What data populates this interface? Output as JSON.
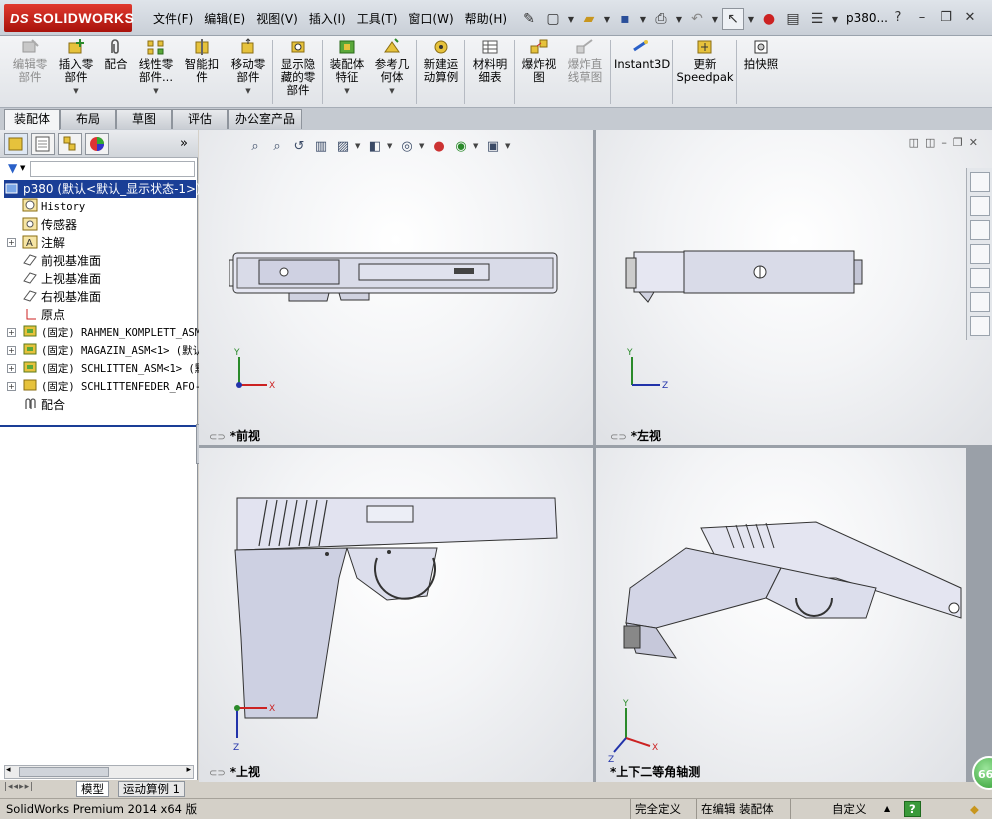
{
  "app": {
    "brand": "SOLIDWORKS",
    "brand_prefix": "DS",
    "doc_title": "p380..."
  },
  "menu": [
    "文件(F)",
    "编辑(E)",
    "视图(V)",
    "插入(I)",
    "工具(T)",
    "窗口(W)",
    "帮助(H)"
  ],
  "commands": [
    {
      "label": "编辑零\n部件",
      "disabled": true
    },
    {
      "label": "插入零\n部件",
      "disabled": false
    },
    {
      "label": "配合",
      "disabled": false
    },
    {
      "label": "线性零\n部件...",
      "disabled": false
    },
    {
      "label": "智能扣\n件",
      "disabled": false
    },
    {
      "label": "移动零\n部件",
      "disabled": false
    },
    {
      "label": "显示隐\n藏的零\n部件",
      "disabled": false
    },
    {
      "label": "装配体\n特征",
      "disabled": false
    },
    {
      "label": "参考几\n何体",
      "disabled": false
    },
    {
      "label": "新建运\n动算例",
      "disabled": false
    },
    {
      "label": "材料明\n细表",
      "disabled": false
    },
    {
      "label": "爆炸视\n图",
      "disabled": false
    },
    {
      "label": "爆炸直\n线草图",
      "disabled": true
    },
    {
      "label": "Instant3D",
      "disabled": false
    },
    {
      "label": "更新\nSpeedpak",
      "disabled": false
    },
    {
      "label": "拍快照",
      "disabled": false
    }
  ],
  "tabs": [
    "装配体",
    "布局",
    "草图",
    "评估",
    "办公室产品"
  ],
  "tree": {
    "root": "p380  (默认<默认_显示状态-1>)",
    "items": [
      {
        "label": "History",
        "mono": true
      },
      {
        "label": "传感器"
      },
      {
        "label": "注解"
      },
      {
        "label": "前视基准面"
      },
      {
        "label": "上视基准面"
      },
      {
        "label": "右视基准面"
      },
      {
        "label": "原点"
      },
      {
        "label": "(固定) RAHMEN_KOMPLETT_ASM",
        "mono": true
      },
      {
        "label": "(固定) MAGAZIN_ASM<1> (默认",
        "mono": true
      },
      {
        "label": "(固定) SCHLITTEN_ASM<1> (默",
        "mono": true
      },
      {
        "label": "(固定) SCHLITTENFEDER_AFO-",
        "mono": true
      },
      {
        "label": "配合"
      }
    ]
  },
  "bottom_tabs": [
    "模型",
    "运动算例 1"
  ],
  "viewports": [
    {
      "label": "*前视",
      "axes": [
        "Y",
        "X"
      ]
    },
    {
      "label": "*左视",
      "axes": [
        "Y",
        "Z"
      ]
    },
    {
      "label": "*上视",
      "axes": [
        "X",
        "Z"
      ]
    },
    {
      "label": "*上下二等角轴测",
      "axes": [
        "Y",
        "X",
        "Z"
      ]
    }
  ],
  "status": {
    "product": "SolidWorks Premium 2014 x64 版",
    "fully_defined": "完全定义",
    "editing": "在编辑 装配体",
    "custom": "自定义",
    "help": "?"
  },
  "badge": "66",
  "colors": {
    "accent": "#1a3e96",
    "brand": "#c5241a"
  }
}
